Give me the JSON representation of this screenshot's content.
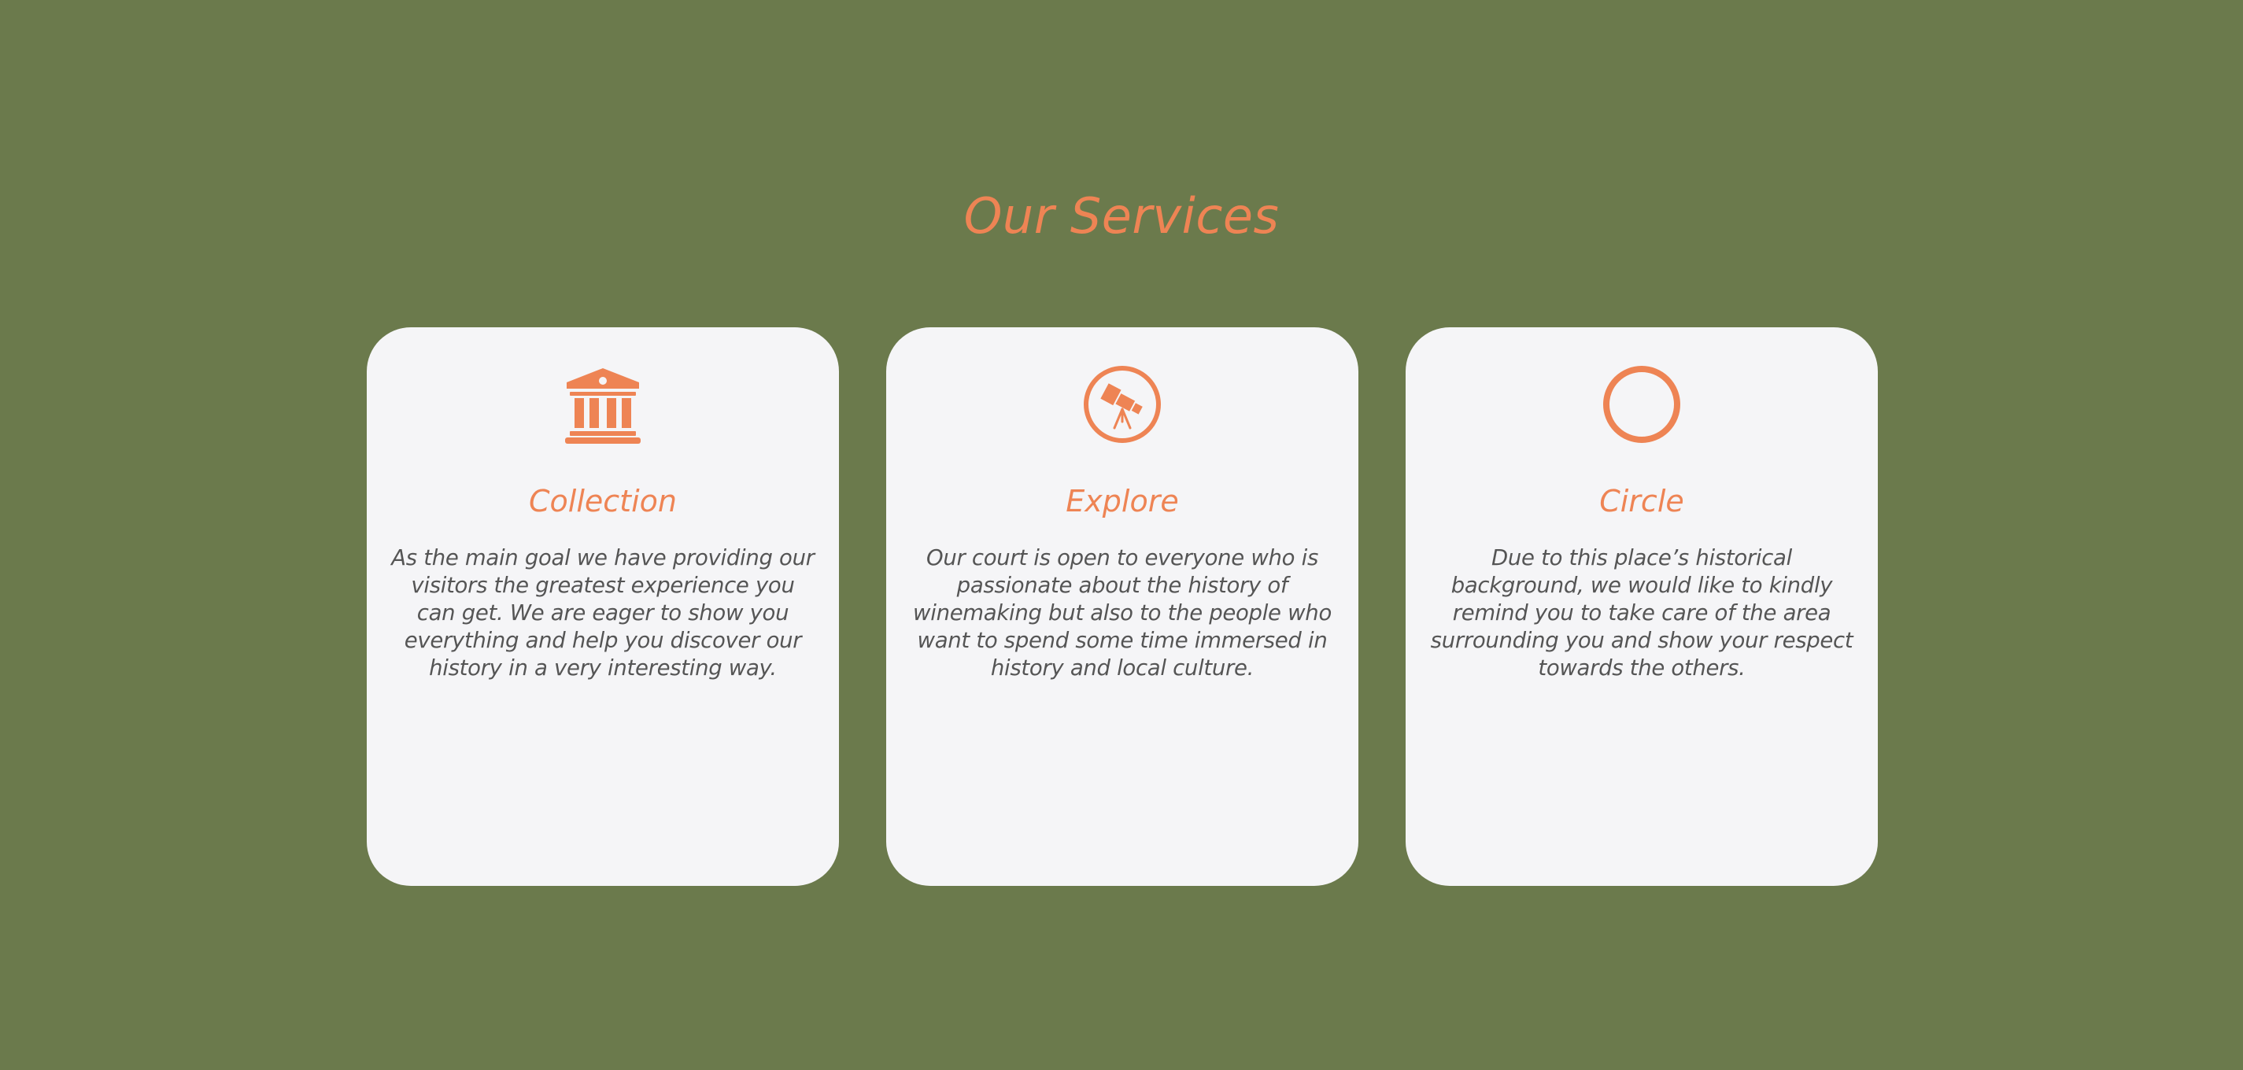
{
  "section": {
    "title": "Our Services"
  },
  "colors": {
    "background": "#6b7a4c",
    "card": "#f5f5f7",
    "accent": "#ee8454",
    "text": "#555555"
  },
  "cards": [
    {
      "icon": "museum-building-icon",
      "title": "Collection",
      "text": "As the main goal we have providing our visitors the greatest experience you can get. We are eager to show you everything and help you discover our history in a very interesting way."
    },
    {
      "icon": "telescope-icon",
      "title": "Explore",
      "text": "Our court is open to everyone who is passionate about the history of winemaking but also to the people who want to spend some time immersed in history and local culture."
    },
    {
      "icon": "circle-icon",
      "title": "Circle",
      "text": "Due to this place’s historical background, we would like to kindly remind you to take care of the area surrounding you and show your respect towards the others."
    }
  ]
}
